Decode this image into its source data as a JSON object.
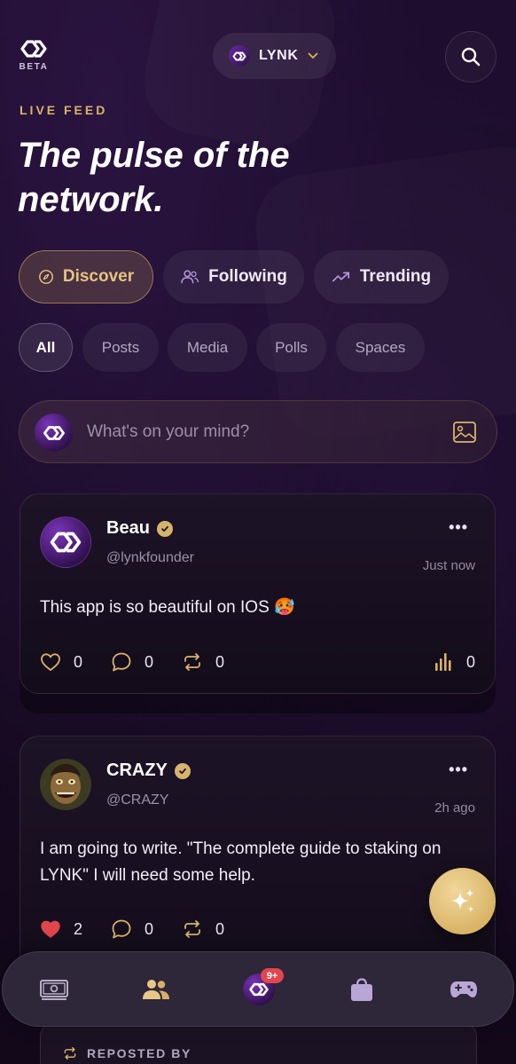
{
  "header": {
    "beta_label": "BETA",
    "network_label": "LYNK"
  },
  "hero": {
    "eyebrow": "LIVE FEED",
    "title": "The pulse of the network."
  },
  "feed_tabs": [
    {
      "label": "Discover",
      "icon": "compass-icon",
      "active": true
    },
    {
      "label": "Following",
      "icon": "people-icon",
      "active": false
    },
    {
      "label": "Trending",
      "icon": "trending-up-icon",
      "active": false
    }
  ],
  "filters": [
    {
      "label": "All",
      "active": true
    },
    {
      "label": "Posts",
      "active": false
    },
    {
      "label": "Media",
      "active": false
    },
    {
      "label": "Polls",
      "active": false
    },
    {
      "label": "Spaces",
      "active": false
    }
  ],
  "composer": {
    "placeholder": "What's on your mind?"
  },
  "posts": [
    {
      "name": "Beau",
      "handle": "@lynkfounder",
      "time": "Just now",
      "text": "This app is so beautiful on IOS 🥵",
      "likes": "0",
      "comments": "0",
      "reposts": "0",
      "views": "0",
      "liked": false
    },
    {
      "name": "CRAZY",
      "handle": "@CRAZY",
      "time": "2h ago",
      "text": "I am going to write. \"The complete guide to staking on LYNK\" I will need some help.",
      "likes": "2",
      "comments": "0",
      "reposts": "0",
      "liked": true
    }
  ],
  "bottom_nav": {
    "badge": "9+"
  },
  "repost": {
    "label": "REPOSTED BY"
  },
  "colors": {
    "accent_gold": "#d9b468",
    "background": "#16091f",
    "like_red": "#e0464b"
  }
}
